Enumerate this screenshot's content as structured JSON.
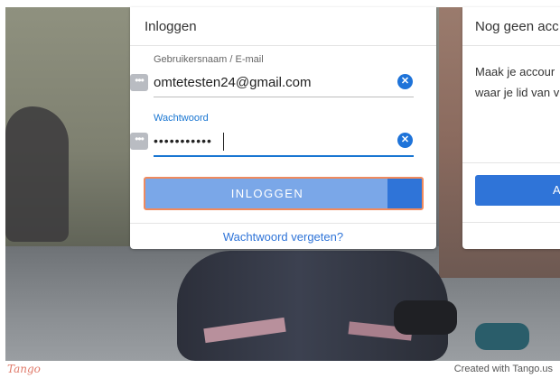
{
  "login": {
    "title": "Inloggen",
    "username_label": "Gebruikersnaam / E-mail",
    "username_value": "omtetesten24@gmail.com",
    "username_icon": "id-card-icon",
    "password_label": "Wachtwoord",
    "password_value": "•••••••••••",
    "password_icon": "id-card-icon",
    "clear_icon": "clear-circle-icon",
    "clear_glyph": "✕",
    "button_label": "INLOGGEN",
    "forgot_link": "Wachtwoord vergeten?"
  },
  "signup": {
    "title": "Nog geen acc",
    "text_line1": "Maak je accour",
    "text_line2": "waar je lid van v",
    "button_label": "A"
  },
  "footer": {
    "logo": "Tango",
    "credit": "Created with Tango.us"
  },
  "colors": {
    "accent": "#2f74d8",
    "button_light": "#7aa7e8",
    "highlight_border": "#f08a5d"
  }
}
